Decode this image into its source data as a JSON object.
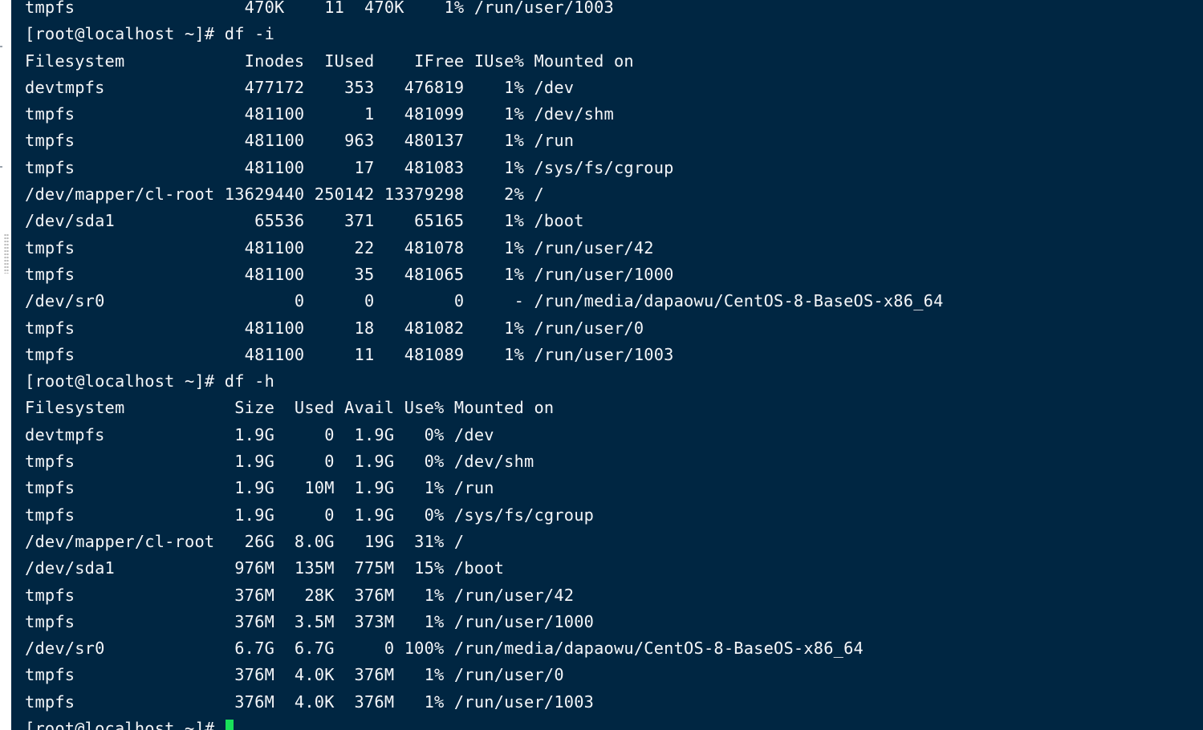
{
  "terminal": {
    "lines": [
      "tmpfs                 470K    11  470K    1% /run/user/1003",
      "[root@localhost ~]# df -i",
      "Filesystem            Inodes  IUsed    IFree IUse% Mounted on",
      "devtmpfs              477172    353   476819    1% /dev",
      "tmpfs                 481100      1   481099    1% /dev/shm",
      "tmpfs                 481100    963   480137    1% /run",
      "tmpfs                 481100     17   481083    1% /sys/fs/cgroup",
      "/dev/mapper/cl-root 13629440 250142 13379298    2% /",
      "/dev/sda1              65536    371    65165    1% /boot",
      "tmpfs                 481100     22   481078    1% /run/user/42",
      "tmpfs                 481100     35   481065    1% /run/user/1000",
      "/dev/sr0                   0      0        0     - /run/media/dapaowu/CentOS-8-BaseOS-x86_64",
      "tmpfs                 481100     18   481082    1% /run/user/0",
      "tmpfs                 481100     11   481089    1% /run/user/1003",
      "[root@localhost ~]# df -h",
      "Filesystem           Size  Used Avail Use% Mounted on",
      "devtmpfs             1.9G     0  1.9G   0% /dev",
      "tmpfs                1.9G     0  1.9G   0% /dev/shm",
      "tmpfs                1.9G   10M  1.9G   1% /run",
      "tmpfs                1.9G     0  1.9G   0% /sys/fs/cgroup",
      "/dev/mapper/cl-root   26G  8.0G   19G  31% /",
      "/dev/sda1            976M  135M  775M  15% /boot",
      "tmpfs                376M   28K  376M   1% /run/user/42",
      "tmpfs                376M  3.5M  373M   1% /run/user/1000",
      "/dev/sr0             6.7G  6.7G     0 100% /run/media/dapaowu/CentOS-8-BaseOS-x86_64",
      "tmpfs                376M  4.0K  376M   1% /run/user/0",
      "tmpfs                376M  4.0K  376M   1% /run/user/1003"
    ],
    "prompt": "[root@localhost ~]# ",
    "colors": {
      "background": "#002642",
      "foreground": "#f4f6f8",
      "cursor": "#19e05a"
    }
  }
}
